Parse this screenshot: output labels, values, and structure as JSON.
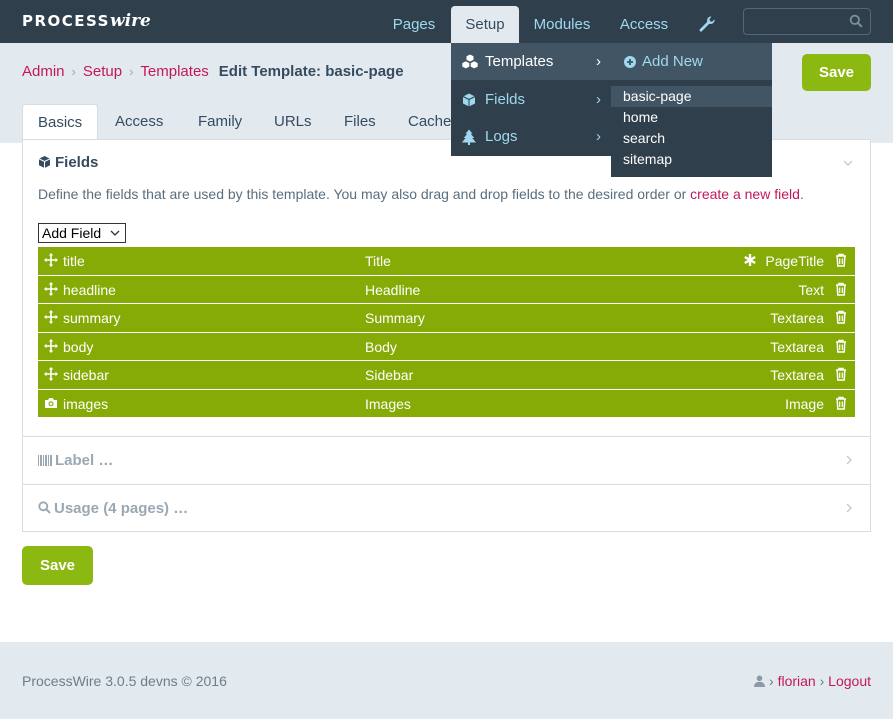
{
  "logo": {
    "process": "PROCESS",
    "wire": "wire"
  },
  "topnav": {
    "pages": "Pages",
    "setup": "Setup",
    "modules": "Modules",
    "access": "Access"
  },
  "breadcrumb": {
    "admin": "Admin",
    "setup": "Setup",
    "templates": "Templates",
    "current": "Edit Template: basic-page",
    "sep": "›"
  },
  "buttons": {
    "save": "Save"
  },
  "tabs": [
    "Basics",
    "Access",
    "Family",
    "URLs",
    "Files",
    "Cache"
  ],
  "fields_section": {
    "title": "Fields",
    "description": "Define the fields that are used by this template. You may also drag and drop fields to the desired order or ",
    "link": "create a new field",
    "period": ".",
    "add_field": "Add Field"
  },
  "field_rows": [
    {
      "name": "title",
      "label": "Title",
      "type": "PageTitle",
      "icon": "move-icon",
      "required": true
    },
    {
      "name": "headline",
      "label": "Headline",
      "type": "Text",
      "icon": "move-icon"
    },
    {
      "name": "summary",
      "label": "Summary",
      "type": "Textarea",
      "icon": "move-icon"
    },
    {
      "name": "body",
      "label": "Body",
      "type": "Textarea",
      "icon": "move-icon"
    },
    {
      "name": "sidebar",
      "label": "Sidebar",
      "type": "Textarea",
      "icon": "move-icon"
    },
    {
      "name": "images",
      "label": "Images",
      "type": "Image",
      "icon": "camera-icon"
    }
  ],
  "sections": {
    "label": "Label …",
    "usage": "Usage (4 pages) …"
  },
  "footer": {
    "copy": "ProcessWire 3.0.5 devns © 2016",
    "user": "florian",
    "logout": "Logout",
    "sep": "›"
  },
  "menu": {
    "items": [
      {
        "label": "Templates",
        "icon": "cubes-icon"
      },
      {
        "label": "Fields",
        "icon": "cube-icon"
      },
      {
        "label": "Logs",
        "icon": "tree-icon"
      }
    ],
    "arrow": "›",
    "submenu": {
      "add_new": "Add New",
      "items": [
        "basic-page",
        "home",
        "search",
        "sitemap"
      ]
    }
  },
  "colors": {
    "topbar": "#2f3f4c",
    "accent": "#8cb812",
    "link": "#c2185b",
    "row": "#87ab06",
    "nav_text": "#9fd8ef"
  }
}
